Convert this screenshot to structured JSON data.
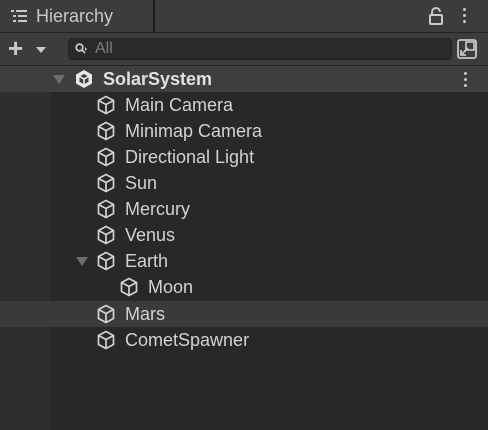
{
  "tab": {
    "title": "Hierarchy",
    "icon": "hierarchy-list-icon"
  },
  "toolbar": {
    "add_icon": "plus-icon",
    "search_placeholder": "All",
    "search_icon": "search-icon",
    "scene_button_icon": "scene-visibility-icon"
  },
  "tree": {
    "root": {
      "label": "SolarSystem",
      "icon": "unity-logo-icon",
      "expanded": true
    },
    "items": [
      {
        "label": "Main Camera",
        "icon": "gameobject-cube-icon"
      },
      {
        "label": "Minimap Camera",
        "icon": "gameobject-cube-icon"
      },
      {
        "label": "Directional Light",
        "icon": "gameobject-cube-icon"
      },
      {
        "label": "Sun",
        "icon": "gameobject-cube-icon"
      },
      {
        "label": "Mercury",
        "icon": "gameobject-cube-icon"
      },
      {
        "label": "Venus",
        "icon": "gameobject-cube-icon"
      },
      {
        "label": "Earth",
        "icon": "gameobject-cube-icon",
        "expanded": true
      },
      {
        "label": "Moon",
        "icon": "gameobject-cube-icon"
      },
      {
        "label": "Mars",
        "icon": "gameobject-cube-icon",
        "hovered": true
      },
      {
        "label": "CometSpawner",
        "icon": "gameobject-cube-icon"
      }
    ]
  }
}
